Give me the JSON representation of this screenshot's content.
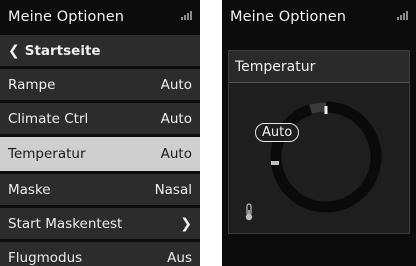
{
  "left_screen": {
    "title": "Meine Optionen",
    "menu": [
      {
        "label": "Startseite",
        "value": "",
        "icon": "chevron-left-icon"
      },
      {
        "label": "Rampe",
        "value": "Auto"
      },
      {
        "label": "Climate Ctrl",
        "value": "Auto"
      },
      {
        "label": "Temperatur",
        "value": "Auto",
        "selected": true
      },
      {
        "label": "Maske",
        "value": "Nasal"
      },
      {
        "label": "Start Maskentest",
        "value": "",
        "icon": "chevron-right-icon"
      },
      {
        "label": "Flugmodus",
        "value": "Aus"
      }
    ]
  },
  "right_screen": {
    "title": "Meine Optionen",
    "panel_title": "Temperatur",
    "setting_value": "Auto",
    "dial_level": 0.95,
    "icon": "thermometer-icon"
  },
  "colors": {
    "background": "#0c0c0c",
    "menu_item": "#2c2c2c",
    "selected_item": "#cfcfcf",
    "text": "#eeeeee"
  }
}
